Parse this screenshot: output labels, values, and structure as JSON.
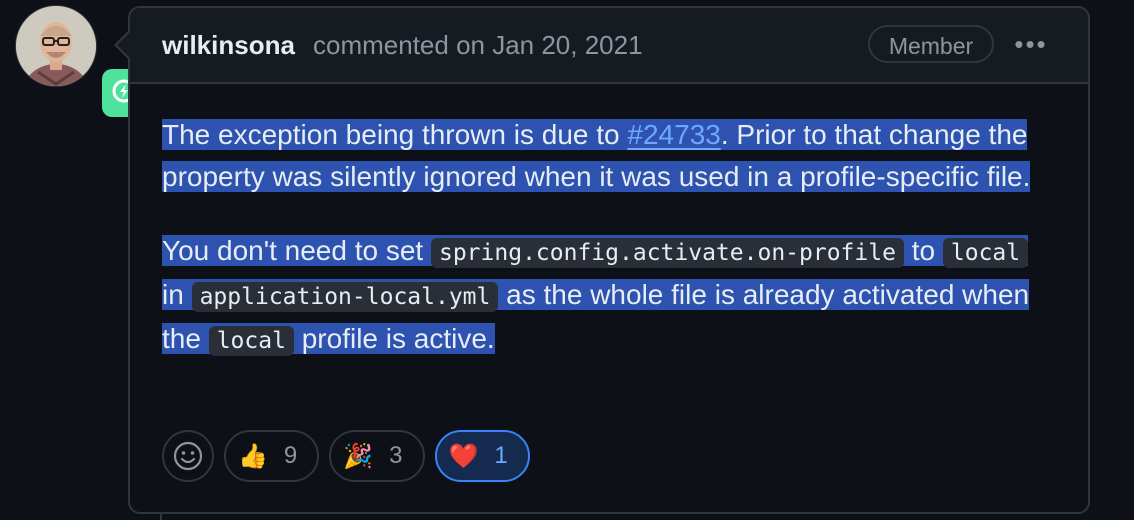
{
  "comment": {
    "author": "wilkinsona",
    "meta": "commented on Jan 20, 2021",
    "role_badge": "Member",
    "more_icon": "kebab-horizontal-icon",
    "body": {
      "p1_before_link": "The exception being thrown is due to ",
      "p1_link": "#24733",
      "p1_after_link": ". Prior to that change the property was silently ignored when it was used in a profile-specific file.",
      "p2_t1": "You don't need to set ",
      "p2_code1": "spring.config.activate.on-profile",
      "p2_t2": " to ",
      "p2_code2": "local",
      "p2_t3": " in ",
      "p2_code3": "application-local.yml",
      "p2_t4": " as the whole file is already activated when the ",
      "p2_code4": "local",
      "p2_t5": " profile is active."
    },
    "reactions": [
      {
        "emoji": "👍",
        "count": "9",
        "active": false
      },
      {
        "emoji": "🎉",
        "count": "3",
        "active": false
      },
      {
        "emoji": "❤️",
        "count": "1",
        "active": true
      }
    ]
  },
  "colors": {
    "background": "#0d1117",
    "header": "#161b22",
    "border": "#30363d",
    "selection": "#2d52b0",
    "link": "#6fa8ff",
    "badge_green": "#4ee39d"
  }
}
